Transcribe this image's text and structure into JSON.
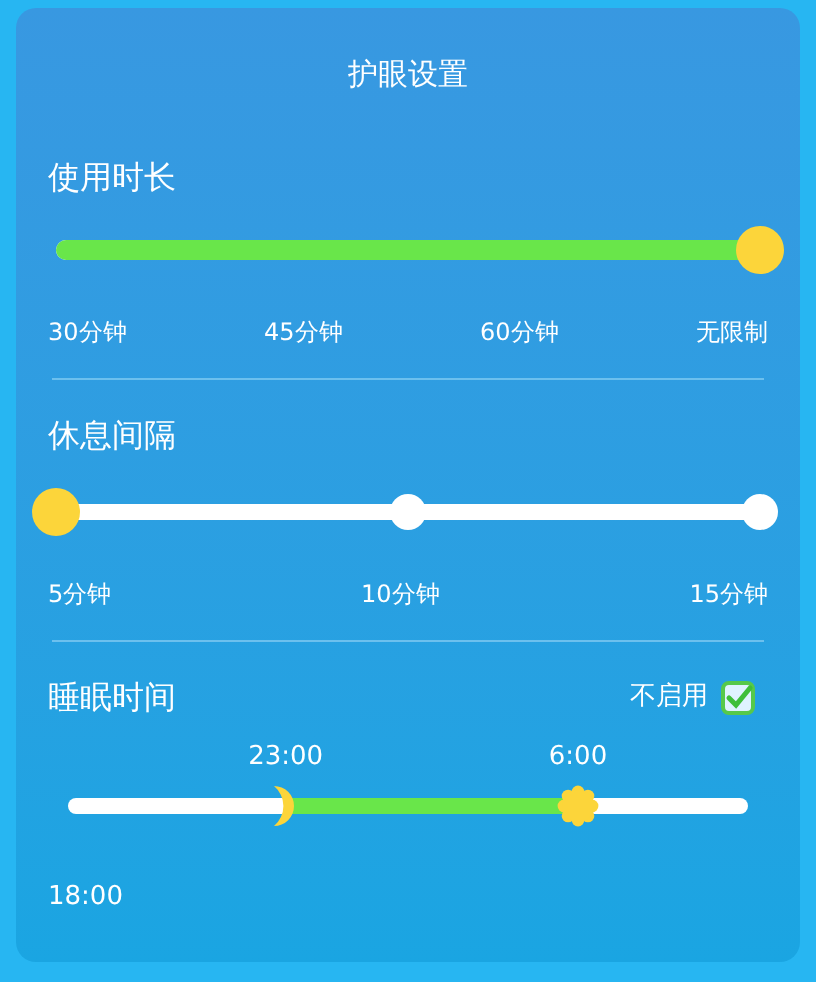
{
  "title": "护眼设置",
  "usage": {
    "label": "使用时长",
    "level": 1,
    "ticks": [
      "30分钟",
      "45分钟",
      "60分钟",
      "无限制"
    ]
  },
  "rest": {
    "label": "休息间隔",
    "level": 0,
    "ticks": [
      "5分钟",
      "10分钟",
      "15分钟"
    ]
  },
  "sleep": {
    "label": "睡眠时间",
    "disable_label": "不启用",
    "checked": true,
    "start": {
      "time": "23:00",
      "level": 0.32
    },
    "end": {
      "time": "6:00",
      "level": 0.75
    },
    "min_label": "18:00"
  }
}
